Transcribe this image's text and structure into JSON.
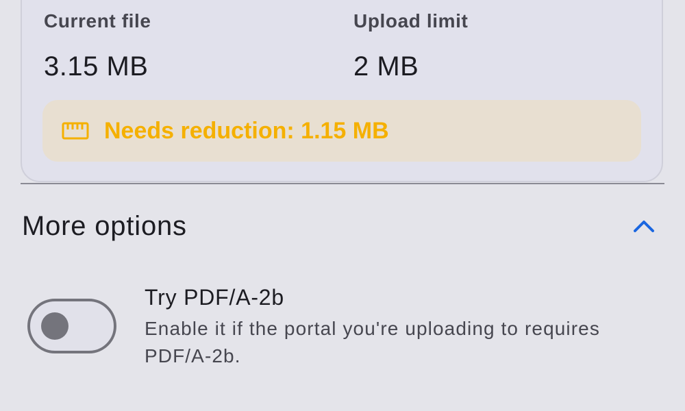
{
  "size_card": {
    "current_file": {
      "label": "Current file",
      "value": "3.15 MB"
    },
    "upload_limit": {
      "label": "Upload limit",
      "value": "2 MB"
    },
    "reduction": {
      "icon": "ruler-icon",
      "text": "Needs reduction: 1.15 MB",
      "color": "#f5b000",
      "background": "#e8dfd1"
    }
  },
  "more_options": {
    "title": "More options",
    "expanded": true,
    "chevron_icon": "chevron-up-icon",
    "accent_color": "#1a66e0",
    "pdfa_option": {
      "title": "Try PDF/A-2b",
      "description": "Enable it if the portal you're uploading to requires PDF/A-2b.",
      "enabled": false
    }
  }
}
